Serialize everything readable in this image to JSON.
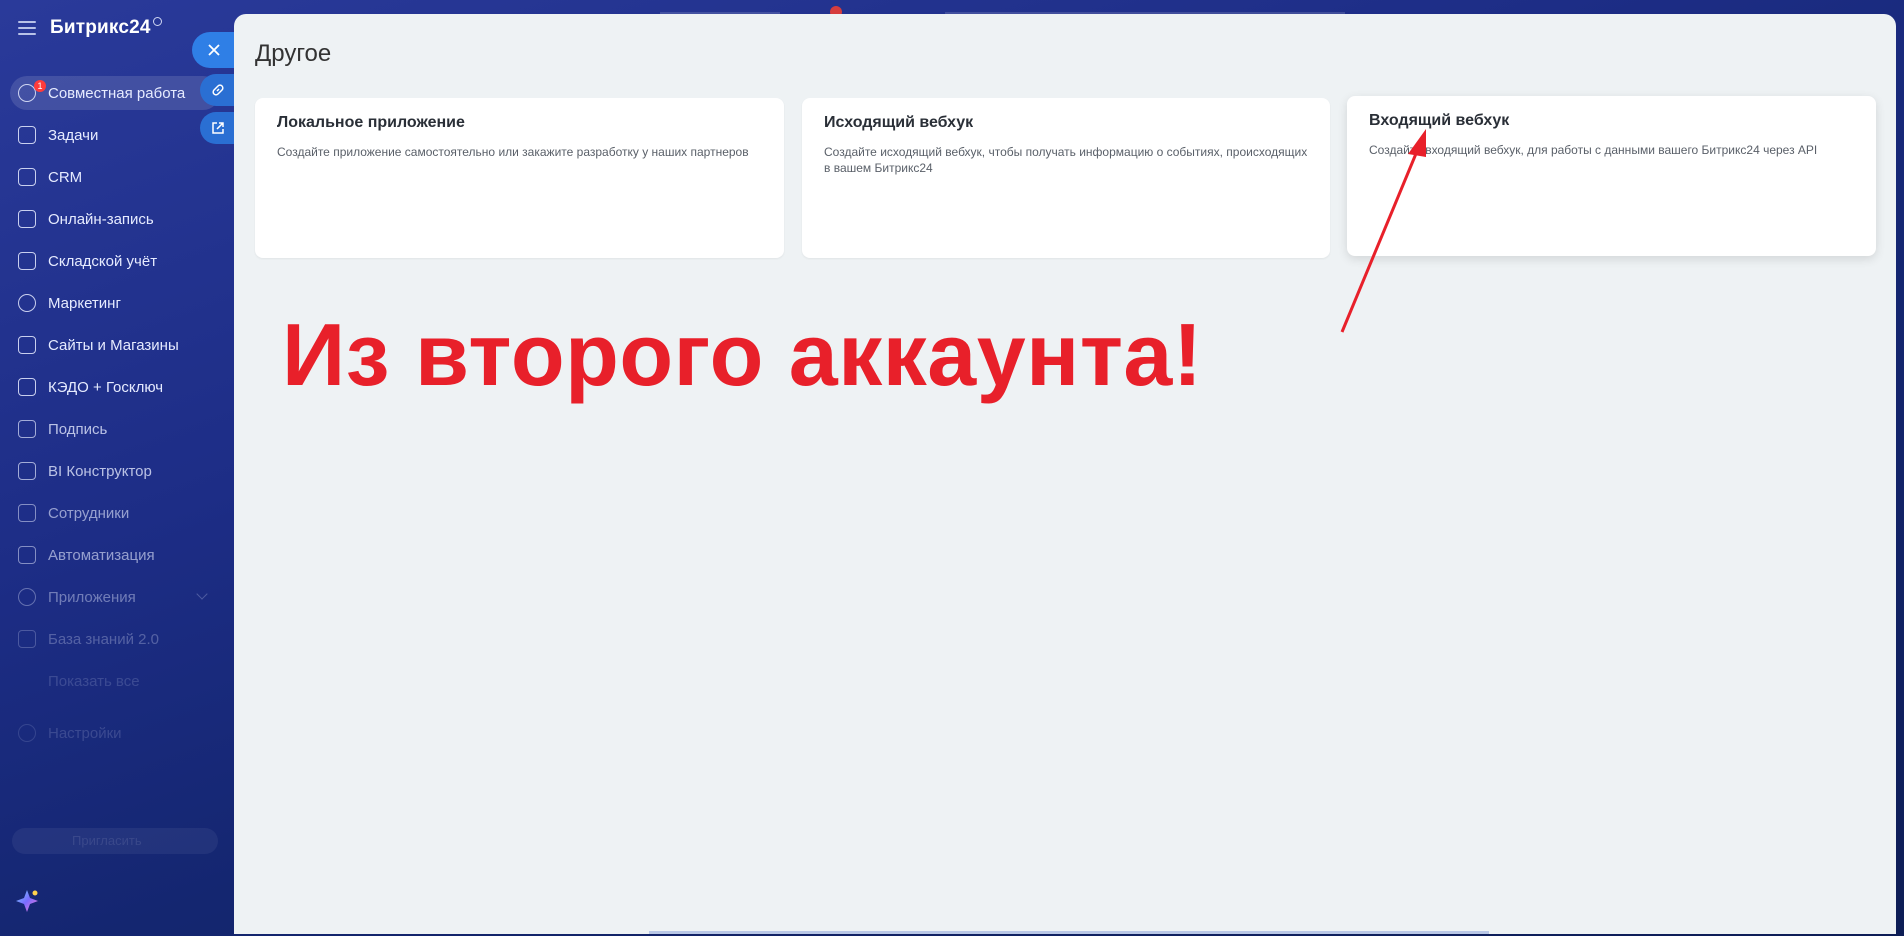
{
  "app": {
    "logo": "Битрикс24"
  },
  "sidebar": {
    "items": [
      {
        "label": "Совместная работа",
        "badge": "1",
        "icon": "chat-icon"
      },
      {
        "label": "Задачи",
        "icon": "checkbox-icon"
      },
      {
        "label": "CRM",
        "icon": "filter-icon"
      },
      {
        "label": "Онлайн-запись",
        "icon": "calendar-icon"
      },
      {
        "label": "Складской учёт",
        "icon": "warehouse-icon"
      },
      {
        "label": "Маркетинг",
        "icon": "target-icon"
      },
      {
        "label": "Сайты и Магазины",
        "icon": "cart-icon"
      },
      {
        "label": "КЭДО + Госключ",
        "icon": "document-icon"
      },
      {
        "label": "Подпись",
        "icon": "pen-icon"
      },
      {
        "label": "BI Конструктор",
        "icon": "chart-icon"
      },
      {
        "label": "Сотрудники",
        "icon": "people-icon"
      },
      {
        "label": "Автоматизация",
        "icon": "robot-icon"
      },
      {
        "label": "Приложения",
        "icon": "apps-icon"
      },
      {
        "label": "База знаний 2.0",
        "icon": "book-icon"
      },
      {
        "label": "Показать все",
        "icon": "chevron-down-icon"
      }
    ],
    "settings_label": "Настройки",
    "invite_label": "Пригласить"
  },
  "panel": {
    "title": "Другое",
    "cards": [
      {
        "title": "Локальное приложение",
        "description": "Создайте приложение самостоятельно или закажите разработку у наших партнеров"
      },
      {
        "title": "Исходящий вебхук",
        "description": "Создайте исходящий вебхук, чтобы получать информацию о событиях, происходящих в вашем Битрикс24"
      },
      {
        "title": "Входящий вебхук",
        "description": "Создайте входящий вебхук, для работы с данными вашего Битрикс24 через API"
      }
    ],
    "annotation": "Из второго аккаунта!"
  },
  "colors": {
    "annotation_red": "#e8202a",
    "side_button_blue": "#2f7fe6",
    "panel_bg": "#eef2f4"
  }
}
